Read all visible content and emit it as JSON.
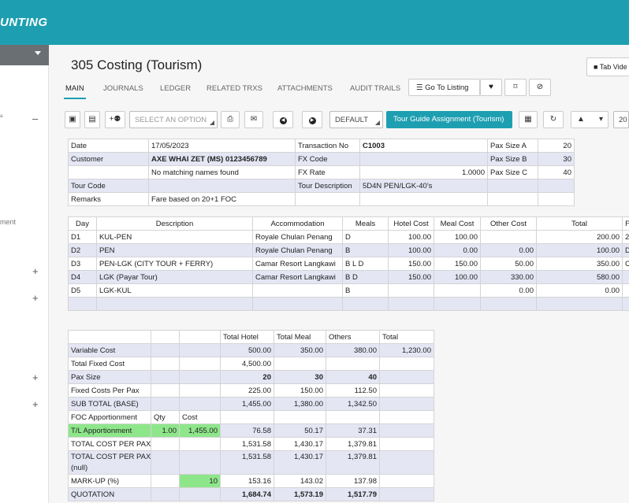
{
  "app": {
    "brand": "UNTING"
  },
  "page": {
    "title": "305 Costing (Tourism)",
    "tab_video_label": "Tab Vide"
  },
  "tabs": [
    "MAIN",
    "JOURNALS",
    "LEDGER",
    "RELATED TRXS",
    "ATTACHMENTS",
    "AUDIT TRAILS"
  ],
  "actions": {
    "go_to_listing": "Go To Listing"
  },
  "toolbar": {
    "option_placeholder": "SELECT AN OPTION",
    "default_select": "DEFAULT",
    "primary_button": "Tour Guide Assignment (Tourism)",
    "extra_value": "20"
  },
  "leftnav": {
    "dash1": "–",
    "dash2": "–",
    "item_text": "ment",
    "plus": "+"
  },
  "header": {
    "date_label": "Date",
    "date": "17/05/2023",
    "txn_label": "Transaction No",
    "txn": "C1003",
    "customer_label": "Customer",
    "customer": "AXE WHAI ZET (MS) 0123456789",
    "no_match": "No matching names found",
    "fx_code_label": "FX Code",
    "fx_code": "",
    "fx_rate_label": "FX Rate",
    "fx_rate": "1.0000",
    "tour_code_label": "Tour Code",
    "tour_code": "",
    "tour_desc_label": "Tour Description",
    "tour_desc": "5D4N PEN/LGK-40's",
    "remarks_label": "Remarks",
    "remarks": "Fare based on 20+1 FOC",
    "pax_a_label": "Pax Size A",
    "pax_a": "20",
    "pax_b_label": "Pax Size B",
    "pax_b": "30",
    "pax_c_label": "Pax Size C",
    "pax_c": "40"
  },
  "itinerary": {
    "columns": [
      "Day",
      "Description",
      "Accommodation",
      "Meals",
      "Hotel Cost",
      "Meal Cost",
      "Other Cost",
      "Total",
      "F"
    ],
    "rows": [
      {
        "day": "D1",
        "desc": "KUL-PEN",
        "acc": "Royale Chulan Penang",
        "meals": "D",
        "hotel": "100.00",
        "meal": "100.00",
        "other": "",
        "total": "200.00",
        "f": "2"
      },
      {
        "day": "D2",
        "desc": "PEN",
        "acc": "Royale Chulan Penang",
        "meals": "B",
        "hotel": "100.00",
        "meal": "0.00",
        "other": "0.00",
        "total": "100.00",
        "f": "D"
      },
      {
        "day": "D3",
        "desc": "PEN-LGK (CITY TOUR + FERRY)",
        "acc": "Camar Resort Langkawi",
        "meals": "B L D",
        "hotel": "150.00",
        "meal": "150.00",
        "other": "50.00",
        "total": "350.00",
        "f": "C"
      },
      {
        "day": "D4",
        "desc": "LGK (Payar Tour)",
        "acc": "Camar Resort Langkawi",
        "meals": "B D",
        "hotel": "150.00",
        "meal": "100.00",
        "other": "330.00",
        "total": "580.00",
        "f": ""
      },
      {
        "day": "D5",
        "desc": "LGK-KUL",
        "acc": "",
        "meals": "B",
        "hotel": "",
        "meal": "",
        "other": "0.00",
        "total": "0.00",
        "f": ""
      }
    ]
  },
  "summary": {
    "columns": [
      "",
      "",
      "",
      "Total Hotel",
      "Total Meal",
      "Others",
      "Total"
    ],
    "rows": [
      {
        "label": "Variable Cost",
        "qty": "",
        "cost": "",
        "hotel": "500.00",
        "meal": "350.00",
        "others": "380.00",
        "total": "1,230.00"
      },
      {
        "label": "Total Fixed Cost",
        "qty": "",
        "cost": "",
        "hotel": "4,500.00",
        "meal": "",
        "others": "",
        "total": ""
      },
      {
        "label": "Pax Size",
        "qty": "",
        "cost": "",
        "hotel": "20",
        "meal": "30",
        "others": "40",
        "total": ""
      },
      {
        "label": "Fixed Costs Per Pax",
        "qty": "",
        "cost": "",
        "hotel": "225.00",
        "meal": "150.00",
        "others": "112.50",
        "total": ""
      },
      {
        "label": "SUB TOTAL (BASE)",
        "qty": "",
        "cost": "",
        "hotel": "1,455.00",
        "meal": "1,380.00",
        "others": "1,342.50",
        "total": ""
      },
      {
        "label": "FOC Apportionment",
        "qty": "Qty",
        "cost": "Cost",
        "hotel": "",
        "meal": "",
        "others": "",
        "total": ""
      },
      {
        "label": "T/L Apportionment",
        "qty": "1.00",
        "cost": "1,455.00",
        "hotel": "76.58",
        "meal": "50.17",
        "others": "37.31",
        "total": ""
      },
      {
        "label": "TOTAL COST PER PAX",
        "qty": "",
        "cost": "",
        "hotel": "1,531.58",
        "meal": "1,430.17",
        "others": "1,379.81",
        "total": ""
      },
      {
        "label": "TOTAL COST PER PAX",
        "label2": "(null)",
        "qty": "",
        "cost": "",
        "hotel": "1,531.58",
        "meal": "1,430.17",
        "others": "1,379.81",
        "total": ""
      },
      {
        "label": "MARK-UP (%)",
        "qty": "",
        "cost": "10",
        "hotel": "153.16",
        "meal": "143.02",
        "others": "137.98",
        "total": ""
      },
      {
        "label": "QUOTATION",
        "qty": "",
        "cost": "",
        "hotel": "1,684.74",
        "meal": "1,573.19",
        "others": "1,517.79",
        "total": ""
      }
    ]
  }
}
